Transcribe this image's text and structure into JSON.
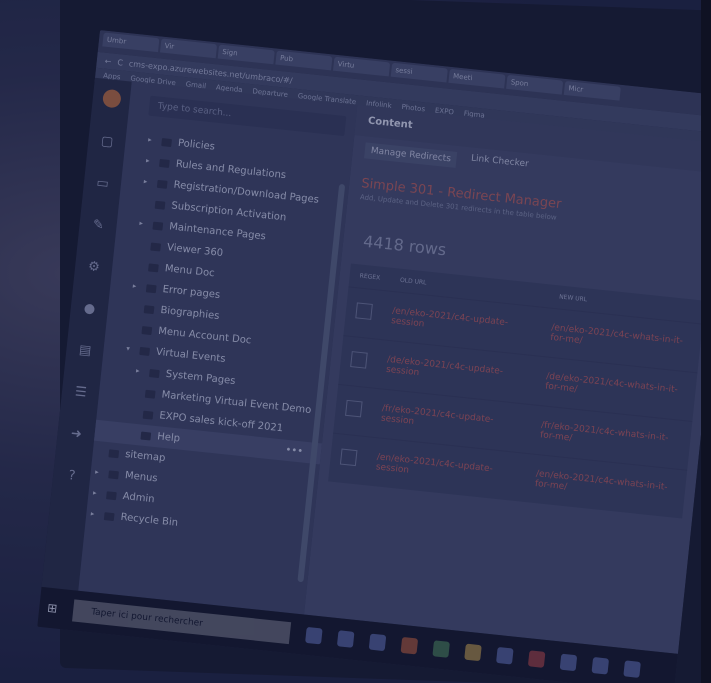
{
  "browser": {
    "tabs": [
      "Umbr",
      "Vir",
      "Sign",
      "Pub",
      "Virtu",
      "sessi",
      "Meeti",
      "Spon",
      "Micr"
    ],
    "address": "cms-expo.azurewebsites.net/umbraco/#/",
    "bookmarks": [
      "Apps",
      "Google Drive",
      "Gmail",
      "Agenda",
      "Departure",
      "Google Translate",
      "Infolink",
      "Photos",
      "EXPO",
      "Figma"
    ]
  },
  "tree": {
    "search_placeholder": "Type to search...",
    "items": [
      "Policies",
      "Rules and Regulations",
      "Registration/Download Pages",
      "Subscription Activation",
      "Maintenance Pages",
      "Viewer 360",
      "Menu Doc",
      "Error pages",
      "Biographies",
      "Menu Account Doc",
      "Virtual Events",
      "System Pages",
      "Marketing Virtual Event Demo",
      "EXPO sales kick-off 2021",
      "Help",
      "sitemap",
      "Menus",
      "Admin",
      "Recycle Bin"
    ]
  },
  "main": {
    "header": "Content",
    "tabs": [
      "Manage Redirects",
      "Link Checker"
    ],
    "title": "Simple 301 - Redirect Manager",
    "subtitle": "Add, Update and Delete 301 redirects in the table below",
    "rows_label": "4418 rows",
    "columns": [
      "REGEX",
      "OLD URL",
      "NEW URL"
    ],
    "rows": [
      {
        "old": "/en/eko-2021/c4c-update-session",
        "new": "/en/eko-2021/c4c-whats-in-it-for-me/"
      },
      {
        "old": "/de/eko-2021/c4c-update-session",
        "new": "/de/eko-2021/c4c-whats-in-it-for-me/"
      },
      {
        "old": "/fr/eko-2021/c4c-update-session",
        "new": "/fr/eko-2021/c4c-whats-in-it-for-me/"
      },
      {
        "old": "/en/eko-2021/c4c-update-session",
        "new": "/en/eko-2021/c4c-whats-in-it-for-me/"
      }
    ]
  },
  "taskbar": {
    "search": "Taper ici pour rechercher"
  }
}
